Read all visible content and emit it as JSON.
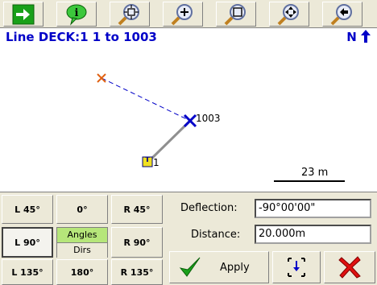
{
  "toolbar": {
    "icons": [
      "go-arrow-icon",
      "info-bubble-icon",
      "zoom-extents-icon",
      "zoom-in-icon",
      "zoom-window-icon",
      "pan-icon",
      "zoom-previous-icon"
    ]
  },
  "map": {
    "title": "Line DECK:1  1 to 1003",
    "north": "N",
    "point_end_label": "1003",
    "point_start_label": "1",
    "point_start_marker": "T",
    "scale_label": "23 m"
  },
  "angles": {
    "l45": "L 45°",
    "zero": "0°",
    "r45": "R 45°",
    "l90": "L 90°",
    "mode_angles": "Angles",
    "mode_dirs": "Dirs",
    "r90": "R 90°",
    "l135": "L 135°",
    "d180": "180°",
    "r135": "R 135°"
  },
  "form": {
    "deflection_label": "Deflection:",
    "deflection_value": "-90°00'00\"",
    "distance_label": "Distance:",
    "distance_value": "20.000m"
  },
  "actions": {
    "apply_label": "Apply"
  },
  "colors": {
    "accent": "#0000c8",
    "angles_active": "#b6e67a"
  }
}
